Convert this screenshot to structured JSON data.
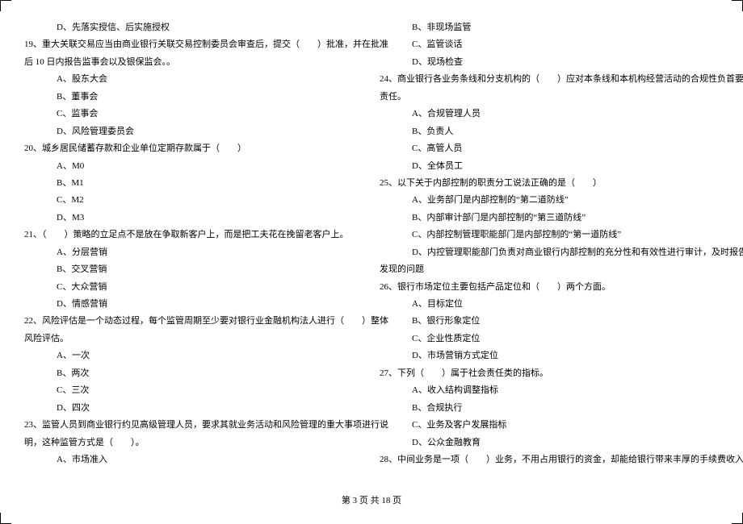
{
  "left": {
    "q18d": "D、先落实授信、后实施授权",
    "q19a": "19、重大关联交易应当由商业银行关联交易控制委员会审查后，提交（　　）批准，并在批准",
    "q19b": "后 10 日内报告监事会以及银保监会。。",
    "q19o": {
      "A": "A、股东大会",
      "B": "B、董事会",
      "C": "C、监事会",
      "D": "D、风险管理委员会"
    },
    "q20": "20、城乡居民储蓄存款和企业单位定期存款属于（　　）",
    "q20o": {
      "A": "A、M0",
      "B": "B、M1",
      "C": "C、M2",
      "D": "D、M3"
    },
    "q21": "21、（　　）策略的立足点不是放在争取新客户上，而是把工夫花在挽留老客户上。",
    "q21o": {
      "A": "A、分层营销",
      "B": "B、交叉营销",
      "C": "C、大众营销",
      "D": "D、情感营销"
    },
    "q22a": "22、风险评估是一个动态过程，每个监管周期至少要对银行业金融机构法人进行（　　）整体",
    "q22b": "风险评估。",
    "q22o": {
      "A": "A、一次",
      "B": "B、两次",
      "C": "C、三次",
      "D": "D、四次"
    },
    "q23a": "23、监管人员到商业银行约见高级管理人员，要求其就业务活动和风险管理的重大事项进行说",
    "q23b": "明，这种监管方式是（　　）。",
    "q23o": {
      "A": "A、市场准入"
    }
  },
  "right": {
    "q23o": {
      "B": "B、非现场监管",
      "C": "C、监管谈话",
      "D": "D、现场检查"
    },
    "q24a": "24、商业银行各业务条线和分支机构的（　　）应对本条线和本机构经营活动的合规性负首要",
    "q24b": "责任。",
    "q24o": {
      "A": "A、合规管理人员",
      "B": "B、负责人",
      "C": "C、高管人员",
      "D": "D、全体员工"
    },
    "q25": "25、以下关于内部控制的职责分工说法正确的是（　　）",
    "q25o": {
      "A": "A、业务部门是内部控制的“第二道防线”",
      "B": "B、内部审计部门是内部控制的“第三道防线”",
      "C": "C、内部控制管理职能部门是内部控制的“第一道防线”",
      "D1": "D、内控管理职能部门负责对商业银行内部控制的充分性和有效性进行审计，及时报告审计",
      "D2": "发现的问题"
    },
    "q26": "26、银行市场定位主要包括产品定位和（　　）两个方面。",
    "q26o": {
      "A": "A、目标定位",
      "B": "B、银行形象定位",
      "C": "C、企业性质定位",
      "D": "D、市场营销方式定位"
    },
    "q27": "27、下列（　　）属于社会责任类的指标。",
    "q27o": {
      "A": "A、收入结构调整指标",
      "B": "B、合规执行",
      "C": "C、业务及客户发展指标",
      "D": "D、公众金融教育"
    },
    "q28": "28、中间业务是一项（　　）业务，不用占用银行的资金，却能给银行带来丰厚的手续费收入，"
  },
  "footer": "第 3 页 共 18 页"
}
